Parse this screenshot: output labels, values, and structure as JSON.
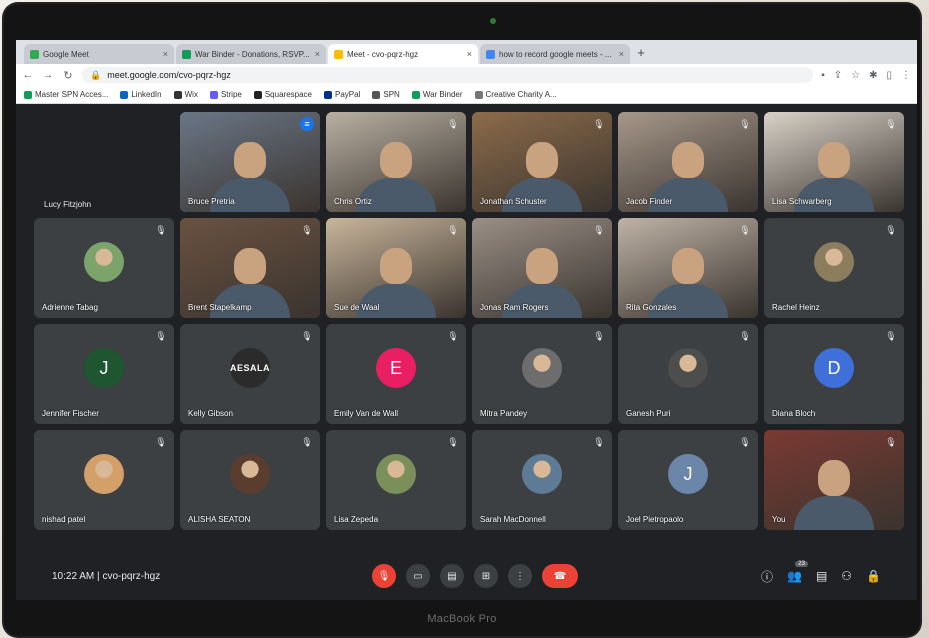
{
  "device": {
    "bezel_label": "MacBook Pro"
  },
  "browser": {
    "tabs": [
      {
        "title": "Google Meet",
        "favicon_color": "#34a853",
        "active": false
      },
      {
        "title": "War Binder - Donations, RSVP...",
        "favicon_color": "#0f9d58",
        "active": false
      },
      {
        "title": "Meet - cvo-pqrz-hgz",
        "favicon_color": "#fbbc04",
        "active": true
      },
      {
        "title": "how to record google meets - ...",
        "favicon_color": "#4285f4",
        "active": false
      }
    ],
    "new_tab": "+",
    "url": "meet.google.com/cvo-pqrz-hgz",
    "bookmarks": [
      {
        "label": "Master SPN Acces...",
        "color": "#0f9d58"
      },
      {
        "label": "LinkedIn",
        "color": "#0a66c2"
      },
      {
        "label": "Wix",
        "color": "#333333"
      },
      {
        "label": "Stripe",
        "color": "#635bff"
      },
      {
        "label": "Squarespace",
        "color": "#222222"
      },
      {
        "label": "PayPal",
        "color": "#003087"
      },
      {
        "label": "SPN",
        "color": "#555555"
      },
      {
        "label": "War Binder",
        "color": "#0f9d58"
      },
      {
        "label": "Creative Charity A...",
        "color": "#777777"
      }
    ]
  },
  "meet": {
    "side_label": "Lucy Fitzjohn",
    "participants": [
      {
        "name": "Bruce Pretria",
        "kind": "video",
        "tone": "#6a7686",
        "speaking": true
      },
      {
        "name": "Chris Ortiz",
        "kind": "video",
        "tone": "#b9b0a2"
      },
      {
        "name": "Jonathan Schuster",
        "kind": "video",
        "tone": "#8c6b4a"
      },
      {
        "name": "Jacob Finder",
        "kind": "video",
        "tone": "#a6978a"
      },
      {
        "name": "Lisa Schwarberg",
        "kind": "video",
        "tone": "#d8d2c8"
      },
      {
        "name": "Adrienne Tabag",
        "kind": "photo",
        "tone": "#7ba36a"
      },
      {
        "name": "Brent Stapelkamp",
        "kind": "video",
        "tone": "#6a5241"
      },
      {
        "name": "Sue de Waal",
        "kind": "video",
        "tone": "#c8b59b"
      },
      {
        "name": "Jonas Ram Rogers",
        "kind": "video",
        "tone": "#9a8f86"
      },
      {
        "name": "Rita Gonzales",
        "kind": "video",
        "tone": "#bfb3a6"
      },
      {
        "name": "Rachel Heinz",
        "kind": "photo",
        "tone": "#8b7d5e"
      },
      {
        "name": "Jennifer Fischer",
        "kind": "letter",
        "letter": "J",
        "color": "#1e5631"
      },
      {
        "name": "Kelly Gibson",
        "kind": "logo",
        "logo_text": "AESALA"
      },
      {
        "name": "Emily Van de Wall",
        "kind": "letter",
        "letter": "E",
        "color": "#e91e63"
      },
      {
        "name": "Mitra Pandey",
        "kind": "photo",
        "tone": "#6d6d6d"
      },
      {
        "name": "Ganesh Puri",
        "kind": "photo",
        "tone": "#4d4d4d"
      },
      {
        "name": "Diana Bloch",
        "kind": "letter",
        "letter": "D",
        "color": "#3f6fd8"
      },
      {
        "name": "nishad patel",
        "kind": "photo",
        "tone": "#d4a06a"
      },
      {
        "name": "ALISHA SEATON",
        "kind": "photo",
        "tone": "#5a3d2e"
      },
      {
        "name": "Lisa Zepeda",
        "kind": "photo",
        "tone": "#7a8f5a"
      },
      {
        "name": "Sarah MacDonnell",
        "kind": "photo",
        "tone": "#5d7b95"
      },
      {
        "name": "Joel Pietropaolo",
        "kind": "letter",
        "letter": "J",
        "color": "#6b86a8"
      },
      {
        "name": "You",
        "kind": "video",
        "tone": "#7a3a32"
      }
    ],
    "bottom": {
      "time": "10:22 AM",
      "separator": "|",
      "meeting_code": "cvo-pqrz-hgz",
      "people_count": "23"
    }
  },
  "colors": {
    "meet_bg": "#202124",
    "tile_bg": "#3c4043",
    "hangup": "#ea4335",
    "speaking_border": "#8ab4f8"
  }
}
